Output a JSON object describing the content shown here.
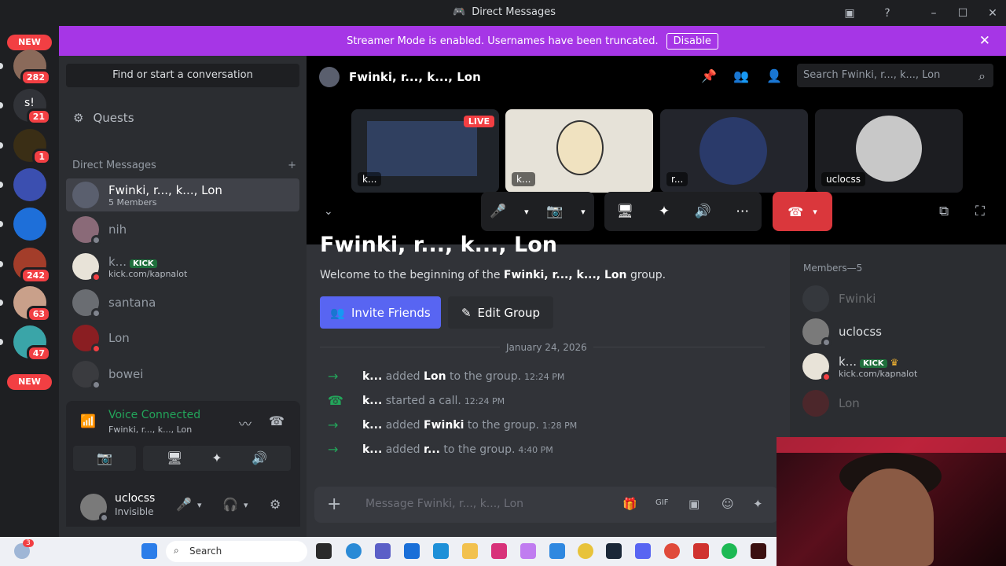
{
  "window": {
    "title": "Direct Messages"
  },
  "banner": {
    "text": "Streamer Mode is enabled. Usernames have been truncated.",
    "disable_label": "Disable"
  },
  "rail": {
    "new_badge_top": "NEW",
    "new_badge_bottom": "NEW",
    "servers": [
      {
        "badge": "282",
        "color": "#8a6a5a"
      },
      {
        "badge": "21",
        "label": "s!",
        "color": "#313338"
      },
      {
        "badge": "1",
        "color": "#3a2e15"
      },
      {
        "badge": "",
        "color": "#3b4fb0"
      },
      {
        "badge": "",
        "color": "#1e6fd9"
      },
      {
        "badge": "242",
        "color": "#a33d2a"
      },
      {
        "badge": "63",
        "color": "#c9a08a"
      },
      {
        "badge": "47",
        "color": "#3aa5a8"
      }
    ]
  },
  "sidebar": {
    "find_label": "Find or start a conversation",
    "quests_label": "Quests",
    "dm_header": "Direct Messages",
    "dm_add": "+",
    "items": [
      {
        "name": "Fwinki, r..., k..., Lon",
        "sub": "5 Members",
        "color": "#5a5f6e"
      },
      {
        "name": "nih",
        "sub": "",
        "color": "#8a6a78"
      },
      {
        "name": "k...",
        "tag": "KICK",
        "sub": "kick.com/kapnalot",
        "color": "#e8e3d8"
      },
      {
        "name": "santana",
        "sub": "",
        "color": "#6a6d72"
      },
      {
        "name": "Lon",
        "sub": "",
        "color": "#8a1e22"
      },
      {
        "name": "bowei",
        "sub": "",
        "color": "#3a3b3f"
      }
    ]
  },
  "voice": {
    "status": "Voice Connected",
    "channel": "Fwinki, r..., k..., Lon"
  },
  "user": {
    "name": "uclocss",
    "status": "Invisible"
  },
  "call": {
    "header": "Fwinki, r..., k..., Lon",
    "search_placeholder": "Search Fwinki, r..., k..., Lon",
    "tiles": [
      {
        "label": "k...",
        "live": "LIVE"
      },
      {
        "label": "k...",
        "live": ""
      },
      {
        "label": "r...",
        "live": ""
      },
      {
        "label": "uclocss",
        "live": ""
      }
    ]
  },
  "chat": {
    "welcome_title": "Fwinki, r..., k..., Lon",
    "welcome_prefix": "Welcome to the beginning of the ",
    "welcome_name": "Fwinki, r..., k..., Lon",
    "welcome_suffix": " group.",
    "invite_label": "Invite Friends",
    "edit_label": "Edit Group",
    "date": "January 24, 2026",
    "messages": [
      {
        "actor": "k...",
        "verb": "added",
        "target": "Lon",
        "rest": "to the group.",
        "time": "12:24 PM",
        "icon": "arrow"
      },
      {
        "actor": "k...",
        "verb": "started a call.",
        "target": "",
        "rest": "",
        "time": "12:24 PM",
        "icon": "phone"
      },
      {
        "actor": "k...",
        "verb": "added",
        "target": "Fwinki",
        "rest": "to the group.",
        "time": "1:28 PM",
        "icon": "arrow"
      },
      {
        "actor": "k...",
        "verb": "added",
        "target": "r...",
        "rest": "to the group.",
        "time": "4:40 PM",
        "icon": "arrow"
      }
    ],
    "composer_placeholder": "Message Fwinki, r..., k..., Lon"
  },
  "members": {
    "header": "Members—5",
    "list": [
      {
        "name": "Fwinki",
        "dim": true,
        "color": "#4a4d55"
      },
      {
        "name": "uclocss",
        "dim": false,
        "color": "#7a7a7a"
      },
      {
        "name": "k...",
        "tag": "KICK",
        "sub": "kick.com/kapnalot",
        "dim": false,
        "color": "#e8e3d8"
      },
      {
        "name": "Lon",
        "dim": true,
        "color": "#8a1e22"
      }
    ]
  },
  "taskbar": {
    "search_label": "Search",
    "notif_badge": "3"
  }
}
